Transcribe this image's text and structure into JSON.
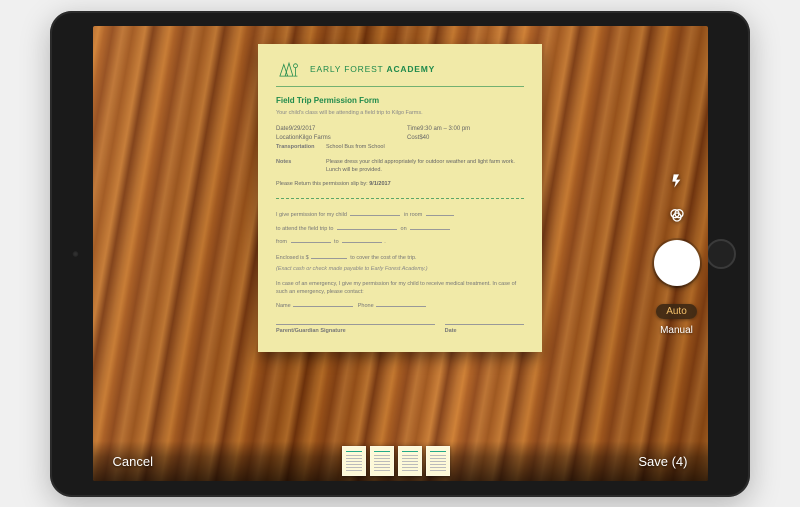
{
  "bottom": {
    "cancel": "Cancel",
    "save": "Save (4)"
  },
  "modes": {
    "auto": "Auto",
    "manual": "Manual"
  },
  "thumbnails_count": 4,
  "document": {
    "brand_light": "EARLY FOREST ",
    "brand_bold": "ACADEMY",
    "title": "Field Trip Permission Form",
    "subtitle": "Your child's class will be attending a field trip to Kilgo Farms.",
    "rows": {
      "date_label": "Date",
      "date_value": "9/29/2017",
      "time_label": "Time",
      "time_value": "9:30 am – 3:00 pm",
      "location_label": "Location",
      "location_value": "Kilgo Farms",
      "cost_label": "Cost",
      "cost_value": "$40",
      "transport_label": "Transportation",
      "transport_value": "School Bus from School",
      "notes_label": "Notes",
      "notes_value": "Please dress your child appropriately for outdoor weather and light farm work. Lunch will be provided."
    },
    "return_prefix": "Please Return this permission slip by: ",
    "return_date": "9/1/2017",
    "perm1a": "I give permission for my child ",
    "perm1b": " in room ",
    "perm2": "to attend the field trip to ",
    "perm2b": " on ",
    "perm3a": "from ",
    "perm3b": " to ",
    "enclosed_a": "Enclosed is  $",
    "enclosed_b": " to cover the cost of the trip.",
    "payable": "(Exact cash or check made payable to Early Forest Academy.)",
    "emergency": "In case of an emergency, I give my permission for my child to receive medical treatment. In case of such an emergency, please contact:",
    "name_label": "Name",
    "phone_label": "Phone",
    "sig_label": "Parent/Guardian Signature",
    "sig_date_label": "Date"
  }
}
